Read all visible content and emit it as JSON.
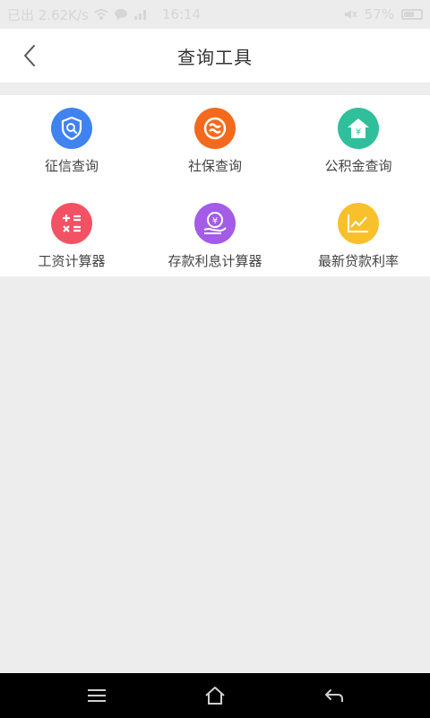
{
  "status_bar": {
    "speed": "已出 2.62K/s",
    "time": "16:14",
    "battery": "57%"
  },
  "header": {
    "title": "查询工具",
    "back_icon": "chevron-left-icon"
  },
  "tools": [
    {
      "label": "征信查询",
      "icon": "credit-shield-search-icon",
      "color": "#3f82f0"
    },
    {
      "label": "社保查询",
      "icon": "social-security-icon",
      "color": "#f36a1c"
    },
    {
      "label": "公积金查询",
      "icon": "housing-fund-house-icon",
      "color": "#2fbf9b"
    },
    {
      "label": "工资计算器",
      "icon": "calculator-icon",
      "color": "#f25264"
    },
    {
      "label": "存款利息计算器",
      "icon": "deposit-interest-icon",
      "color": "#a35be8"
    },
    {
      "label": "最新贷款利率",
      "icon": "loan-rate-chart-icon",
      "color": "#f8c12b"
    }
  ],
  "nav_bar": {
    "menu_icon": "menu-icon",
    "home_icon": "home-icon",
    "back_icon": "back-arrow-icon"
  }
}
